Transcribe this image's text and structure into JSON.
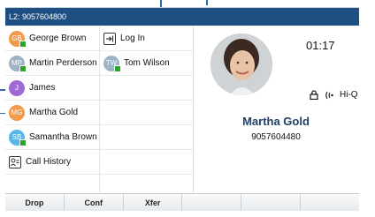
{
  "titlebar": {
    "label": "L2: 9057604800"
  },
  "contacts_left": [
    {
      "initials": "GB",
      "name": "George Brown",
      "color": "#f2994a",
      "online": true
    },
    {
      "initials": "MP",
      "name": "Martin Perderson",
      "color": "#9fb3c8",
      "online": true
    },
    {
      "initials": "J",
      "name": "James",
      "color": "#a06ad6",
      "online": false
    },
    {
      "initials": "MG",
      "name": "Martha Gold",
      "color": "#f2994a",
      "online": false
    },
    {
      "initials": "SB",
      "name": "Samantha Brown",
      "color": "#56b6e8",
      "online": true
    }
  ],
  "call_history": {
    "label": "Call History",
    "icon": "call-history-icon"
  },
  "contacts_right": [
    {
      "type": "action",
      "label": "Log In",
      "icon": "login-icon"
    },
    {
      "type": "contact",
      "initials": "TW",
      "name": "Tom Wilson",
      "color": "#9fb3c8",
      "online": true
    }
  ],
  "call": {
    "timer": "01:17",
    "hiq": "Hi-Q",
    "name": "Martha Gold",
    "number": "9057604480"
  },
  "softkeys": [
    "Drop",
    "Conf",
    "Xfer",
    "",
    "",
    ""
  ]
}
